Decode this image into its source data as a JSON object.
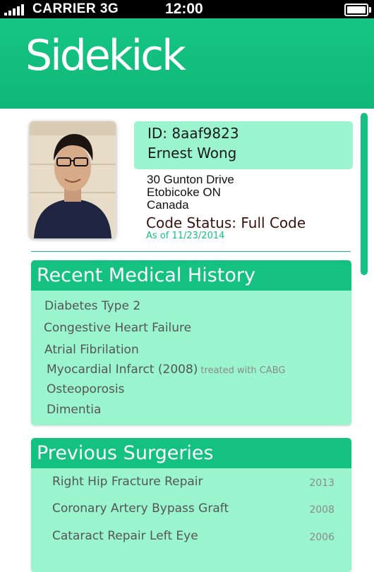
{
  "status_bar": {
    "carrier": "CARRIER",
    "network": "3G",
    "time": "12:00"
  },
  "header": {
    "app_title": "Sidekick",
    "brand_color": "#14c181"
  },
  "patient": {
    "id_label": "ID: 8aaf9823",
    "name": "Ernest Wong",
    "address_line1": "30 Gunton Drive",
    "address_line2": "Etobicoke ON",
    "address_line3": "Canada",
    "code_status": "Code Status: Full Code",
    "as_of": "As of 11/23/2014"
  },
  "medical_history": {
    "title": "Recent Medical History",
    "items": [
      {
        "label": "Diabetes Type 2",
        "note": ""
      },
      {
        "label": "Congestive Heart Failure",
        "note": ""
      },
      {
        "label": "Atrial Fibrilation",
        "note": ""
      },
      {
        "label": "Myocardial Infarct (2008)",
        "note": "treated with CABG"
      },
      {
        "label": "Osteoporosis",
        "note": ""
      },
      {
        "label": "Dimentia",
        "note": ""
      }
    ]
  },
  "surgeries": {
    "title": "Previous Surgeries",
    "items": [
      {
        "label": "Right Hip Fracture Repair",
        "year": "2013"
      },
      {
        "label": "Coronary Artery Bypass Graft",
        "year": "2008"
      },
      {
        "label": "Cataract Repair Left Eye",
        "year": "2006"
      }
    ]
  },
  "colors": {
    "accent": "#14c181",
    "card_background": "#9af5cf",
    "as_of_text": "#14bf80",
    "code_status_text": "#3b1010"
  }
}
